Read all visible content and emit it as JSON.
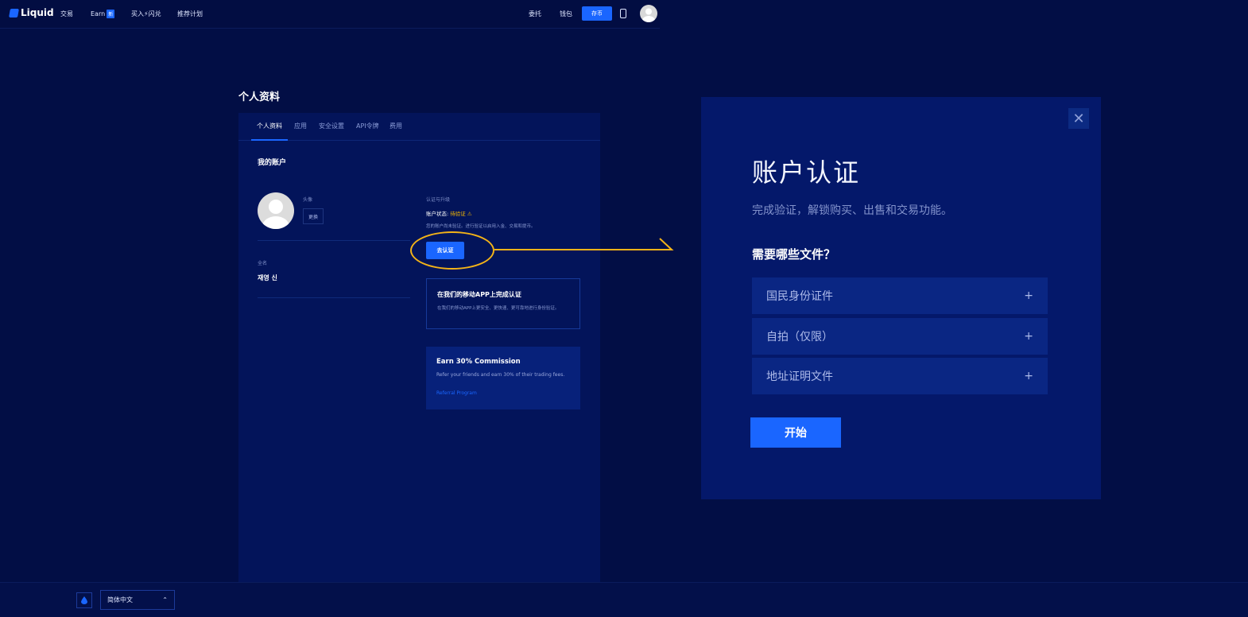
{
  "nav": {
    "logo": "Liquid",
    "items": [
      {
        "label": "交易"
      },
      {
        "label": "Earn",
        "badge": "新"
      },
      {
        "label": "买入⚡闪兑"
      },
      {
        "label": "推荐计划"
      }
    ],
    "right": {
      "orders": "委托",
      "wallet": "钱包",
      "deposit": "存币"
    }
  },
  "profile_page": {
    "title": "个人资料",
    "tabs": [
      "个人资料",
      "应用",
      "安全设置",
      "API令牌",
      "费用"
    ],
    "section_title": "我的账户",
    "avatar_label": "头像",
    "change_button": "更换",
    "name_label": "全名",
    "name_value": "재영 신",
    "verification": {
      "heading": "认证与升级",
      "status_label": "账户状态:",
      "status_value": "待验证 ⚠",
      "description": "您的账户尚未验证。进行验证以启用入金、交易和提币。",
      "button": "去认证"
    },
    "app_card": {
      "title": "在我们的移动APP上完成认证",
      "description": "在我们的移动APP上更安全、更快速、更可靠地进行身份验证。"
    },
    "earn_card": {
      "title": "Earn 30% Commission",
      "description": "Refer your friends and earn 30% of their trading fees.",
      "link": "Referral Program"
    }
  },
  "modal": {
    "close": "✕",
    "title": "账户认证",
    "subtitle": "完成验证，解锁购买、出售和交易功能。",
    "question": "需要哪些文件？",
    "documents": [
      {
        "label": "国民身份证件",
        "icon": "+"
      },
      {
        "label": "自拍（仅限）",
        "icon": "+"
      },
      {
        "label": "地址证明文件",
        "icon": "+"
      }
    ],
    "start_button": "开始"
  },
  "footer": {
    "language": "简体中文",
    "chevron": "⌃"
  },
  "colors": {
    "background": "#020e45",
    "accent": "#1a66ff",
    "warning": "#f5b800",
    "highlight": "#f3b318"
  }
}
